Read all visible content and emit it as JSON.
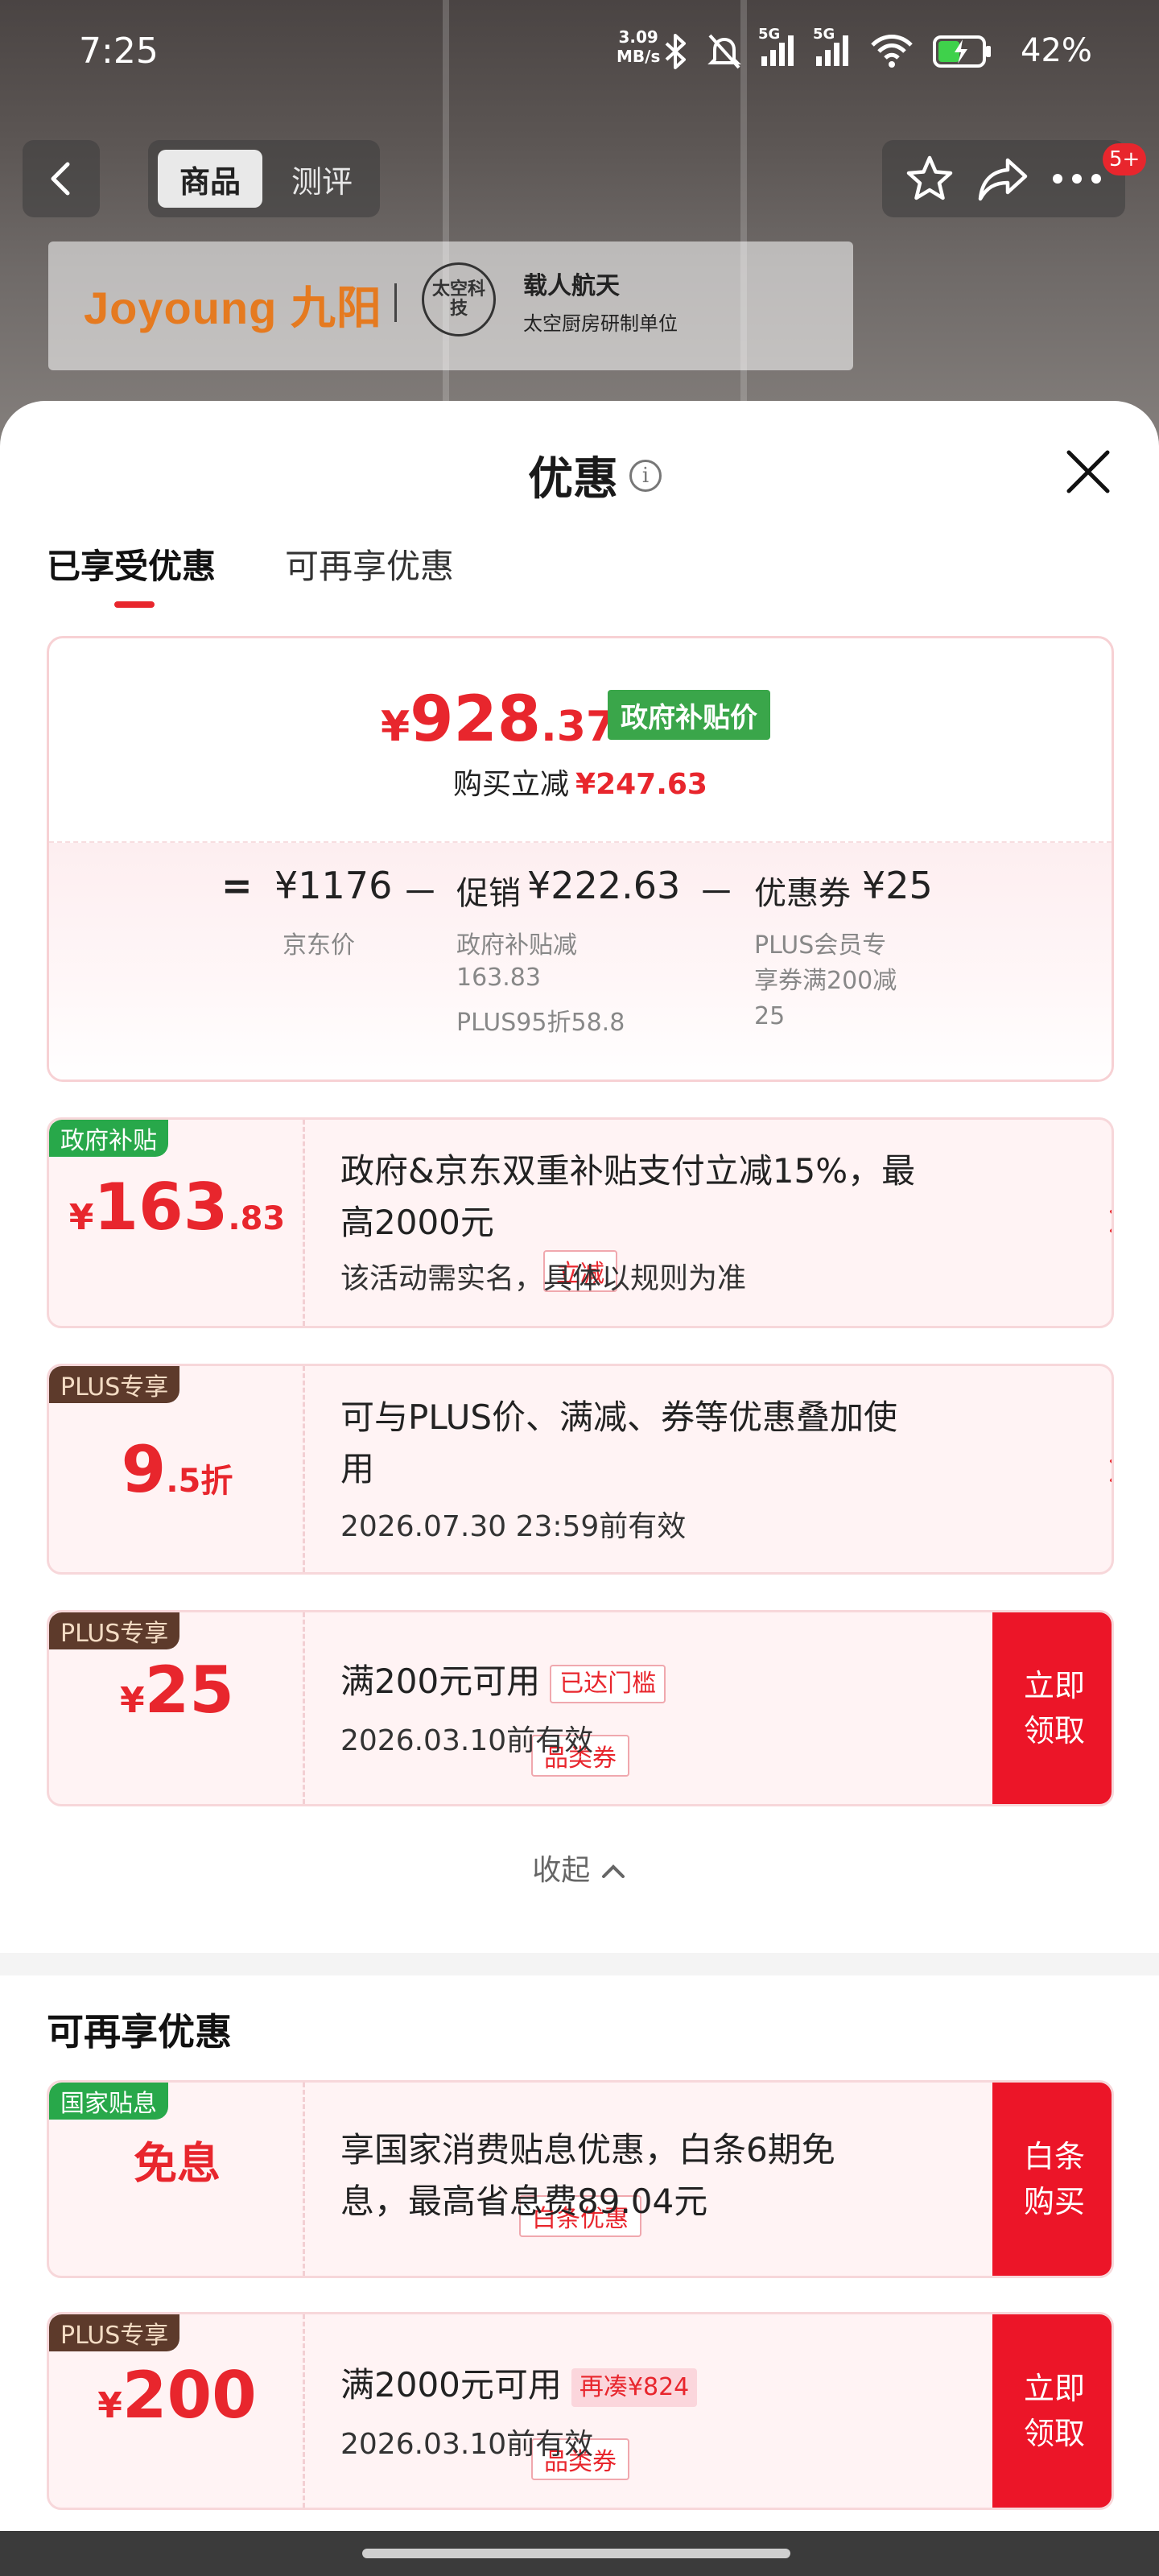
{
  "status_bar": {
    "time": "7:25",
    "speed_value": "3.09",
    "speed_unit": "MB/s",
    "signal_1": "5G",
    "signal_2": "5G",
    "battery": "42%"
  },
  "nav": {
    "tab_product": "商品",
    "tab_review": "测评",
    "badge": "5+"
  },
  "brand": {
    "logo": "Joyoung 九阳",
    "badge": "太空科技",
    "line1": "载人航天",
    "line2": "太空厨房研制单位"
  },
  "sheet": {
    "title": "优惠",
    "tabs": [
      "已享受优惠",
      "可再享优惠"
    ]
  },
  "summary": {
    "currency": "¥",
    "price_int": "928",
    "price_dec": ".37",
    "price_tag": "政府补贴价",
    "direct_cut_label": "购买立减",
    "direct_cut_amount": "¥247.63",
    "eq": "=",
    "jd_price": "¥1176",
    "jd_price_label": "京东价",
    "minus1": "－",
    "promo_label": "促销",
    "promo_amount": "¥222.63",
    "promo_sub1": "政府补贴减",
    "promo_sub1b": "163.83",
    "promo_sub2": "PLUS95折58.8",
    "minus2": "－",
    "coupon_label": "优惠券",
    "coupon_amount": "¥25",
    "coupon_sub1": "PLUS会员专",
    "coupon_sub2": "享券满200减",
    "coupon_sub3": "25"
  },
  "cards": [
    {
      "corner": "政府补贴",
      "yen": "¥",
      "int": "163",
      "dec": ".83",
      "pill": "立减",
      "desc1": "政府&京东双重补贴支付立减15%，最",
      "desc2": "高2000元",
      "sub": "该活动需实名，具体以规则为准"
    },
    {
      "corner": "PLUS专享",
      "int": "9",
      "dec": ".5",
      "unit": "折",
      "desc1": "可与PLUS价、满减、券等优惠叠加使",
      "desc2": "用",
      "sub": "2026.07.30 23:59前有效"
    },
    {
      "corner": "PLUS专享",
      "yen": "¥",
      "int": "25",
      "pill": "品类券",
      "desc1": "满200元可用",
      "tag": "已达门槛",
      "sub": "2026.03.10前有效",
      "cta1": "立即",
      "cta2": "领取"
    }
  ],
  "collapse_label": "收起",
  "more_section": {
    "title": "可再享优惠",
    "cards": [
      {
        "corner": "国家贴息",
        "main": "免息",
        "pill": "白条优惠",
        "desc1": "享国家消费贴息优惠，白条6期免",
        "desc2": "息，最高省息费89.04元",
        "cta1": "白条",
        "cta2": "购买"
      },
      {
        "corner": "PLUS专享",
        "yen": "¥",
        "int": "200",
        "pill": "品类券",
        "desc1": "满2000元可用",
        "tag": "再凑¥824",
        "sub": "2026.03.10前有效",
        "cta1": "立即",
        "cta2": "领取"
      }
    ]
  },
  "colors": {
    "accent_red": "#e8262d",
    "gov_green": "#3aa64a",
    "plus_brown": "#5d3a2b",
    "cta_red": "#ec1528"
  }
}
